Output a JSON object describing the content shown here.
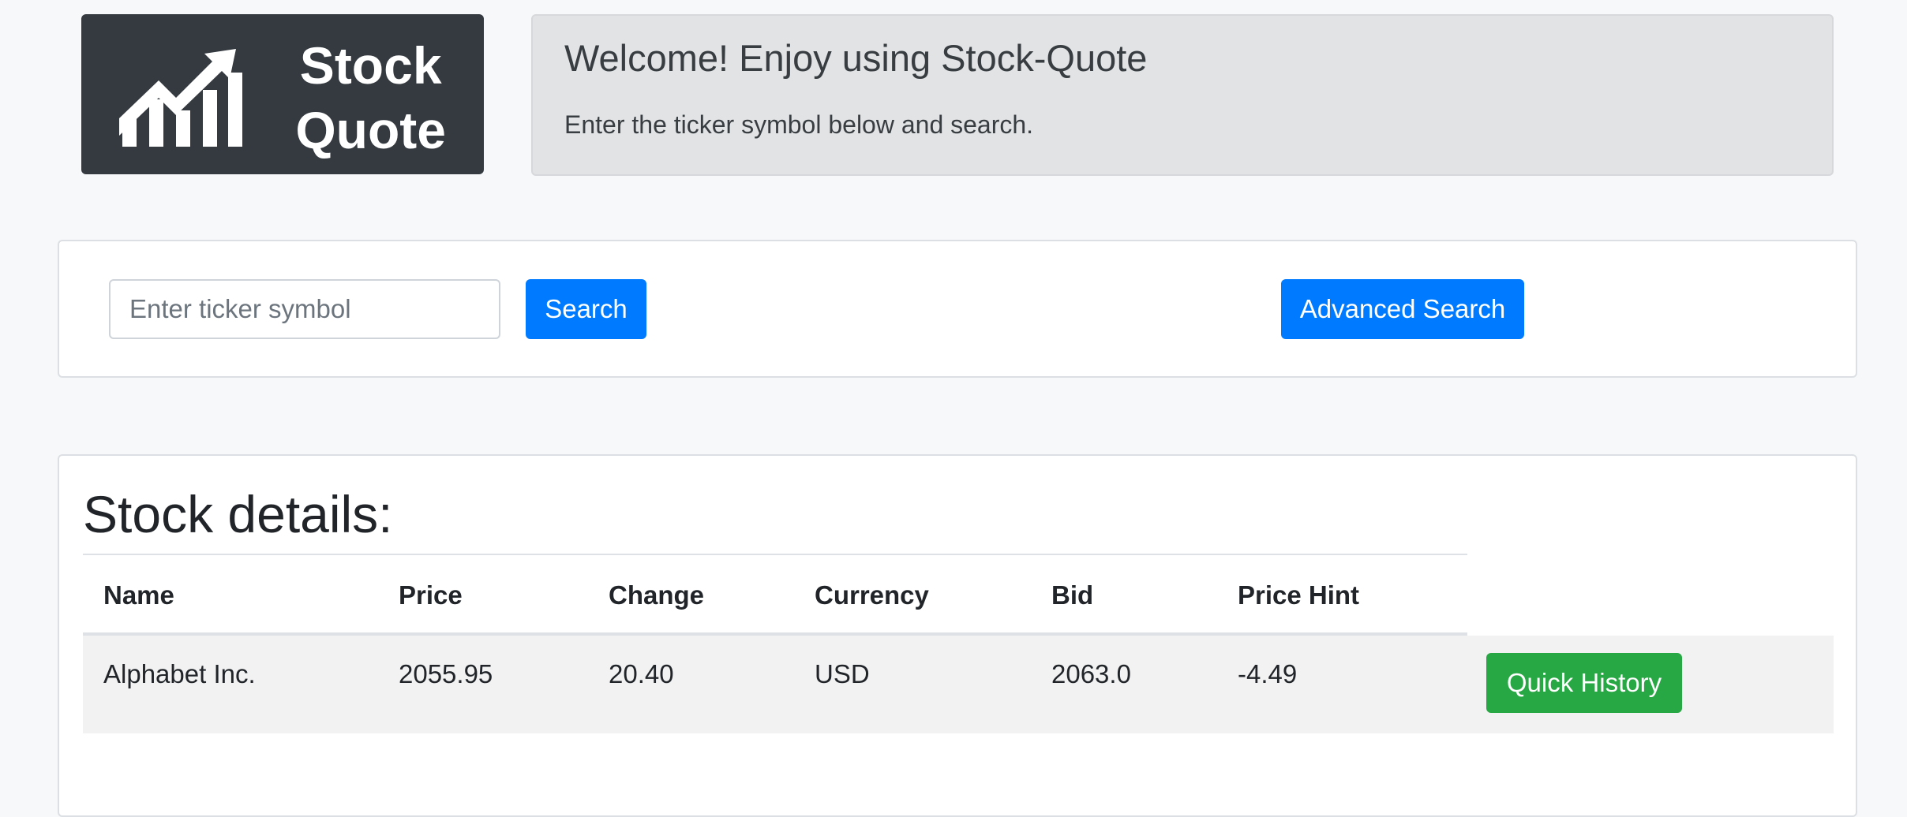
{
  "logo": {
    "line1": "Stock",
    "line2": "Quote",
    "icon": "bar-chart-trending-up-icon"
  },
  "welcome": {
    "title": "Welcome! Enjoy using Stock-Quote",
    "subtitle": "Enter the ticker symbol below and search."
  },
  "search": {
    "placeholder": "Enter ticker symbol",
    "value": "",
    "search_label": "Search",
    "advanced_label": "Advanced Search"
  },
  "details": {
    "title": "Stock details:",
    "columns": [
      "Name",
      "Price",
      "Change",
      "Currency",
      "Bid",
      "Price Hint"
    ],
    "rows": [
      [
        "Alphabet Inc.",
        "2055.95",
        "20.40",
        "USD",
        "2063.0",
        "-4.49"
      ]
    ],
    "history_label": "Quick History"
  },
  "colors": {
    "primary": "#007bff",
    "success": "#28a745",
    "dark": "#343a40",
    "welcome_bg": "#e2e3e5"
  }
}
